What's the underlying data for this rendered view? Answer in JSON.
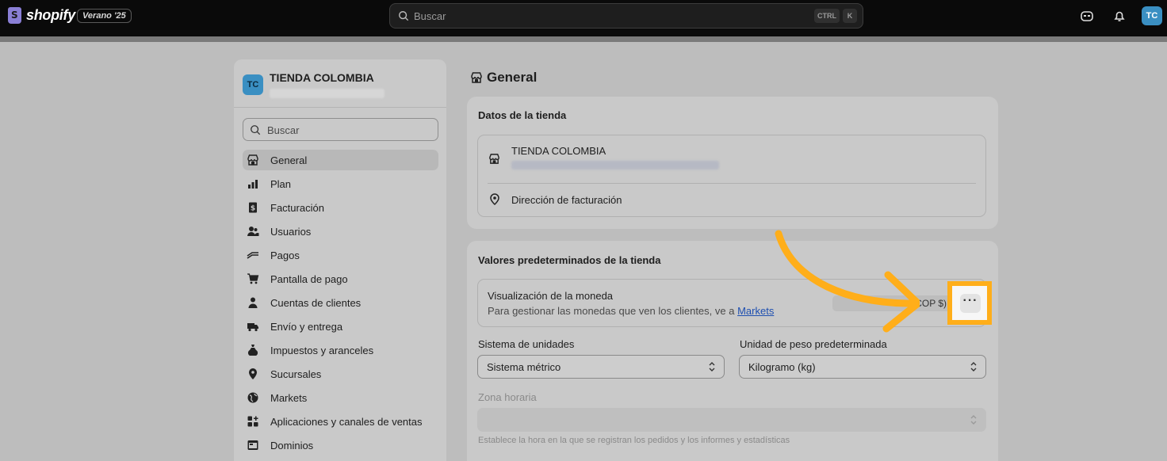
{
  "topbar": {
    "brand": "shopify",
    "edition": "Verano '25",
    "search_placeholder": "Buscar",
    "shortcut_ctrl": "CTRL",
    "shortcut_k": "K",
    "user_initials": "TC"
  },
  "sidebar": {
    "store_initials": "TC",
    "store_name": "TIENDA COLOMBIA",
    "search_placeholder": "Buscar",
    "items": [
      {
        "label": "General",
        "icon": "store-icon",
        "active": true
      },
      {
        "label": "Plan",
        "icon": "plan-icon"
      },
      {
        "label": "Facturación",
        "icon": "billing-icon"
      },
      {
        "label": "Usuarios",
        "icon": "users-icon"
      },
      {
        "label": "Pagos",
        "icon": "payments-icon"
      },
      {
        "label": "Pantalla de pago",
        "icon": "cart-icon"
      },
      {
        "label": "Cuentas de clientes",
        "icon": "person-icon"
      },
      {
        "label": "Envío y entrega",
        "icon": "truck-icon"
      },
      {
        "label": "Impuestos y aranceles",
        "icon": "tax-bag-icon"
      },
      {
        "label": "Sucursales",
        "icon": "location-icon"
      },
      {
        "label": "Markets",
        "icon": "globe-icon"
      },
      {
        "label": "Aplicaciones y canales de ventas",
        "icon": "apps-icon"
      },
      {
        "label": "Dominios",
        "icon": "domain-icon"
      }
    ]
  },
  "main": {
    "page_title": "General",
    "store_details": {
      "title": "Datos de la tienda",
      "store_name": "TIENDA COLOMBIA",
      "billing_address": "Dirección de facturación"
    },
    "defaults": {
      "title": "Valores predeterminados de la tienda",
      "currency_label": "Visualización de la moneda",
      "currency_desc": "Para gestionar las monedas que ven los clientes, ve a",
      "currency_link": "Markets",
      "currency_value": "COP $)",
      "more_actions": "···",
      "units_label": "Sistema de unidades",
      "units_value": "Sistema métrico",
      "weight_label": "Unidad de peso predeterminada",
      "weight_value": "Kilogramo (kg)",
      "timezone_label": "Zona horaria",
      "timezone_help": "Establece la hora en la que se registran los pedidos y los informes y estadísticas"
    }
  },
  "colors": {
    "highlight": "#ffae1a",
    "topbar": "#0a0a0a",
    "avatar": "#3a8fc2"
  }
}
